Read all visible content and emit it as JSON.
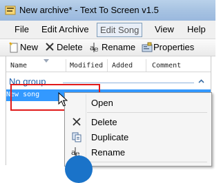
{
  "window": {
    "title": "New archive* - Text To Screen v1.5"
  },
  "menubar": {
    "items": [
      {
        "label": "File"
      },
      {
        "label": "Edit Archive"
      },
      {
        "label": "Edit Song",
        "active": true
      },
      {
        "label": "View"
      },
      {
        "label": "Help"
      }
    ]
  },
  "toolbar": {
    "new_label": "New",
    "delete_label": "Delete",
    "rename_label": "Rename",
    "properties_label": "Properties"
  },
  "list": {
    "columns": [
      "Name",
      "Modified",
      "Added",
      "Comment"
    ],
    "group_label": "No group",
    "selected_item": "New song"
  },
  "context_menu": {
    "items": [
      {
        "label": "Open",
        "icon": "none"
      },
      {
        "label": "Delete",
        "icon": "x-icon"
      },
      {
        "label": "Duplicate",
        "icon": "duplicate-icon"
      },
      {
        "label": "Rename",
        "icon": "rename-icon"
      }
    ]
  },
  "colors": {
    "selection": "#3399ff",
    "highlight_box": "#e01919",
    "group_text": "#1f5fa8"
  }
}
